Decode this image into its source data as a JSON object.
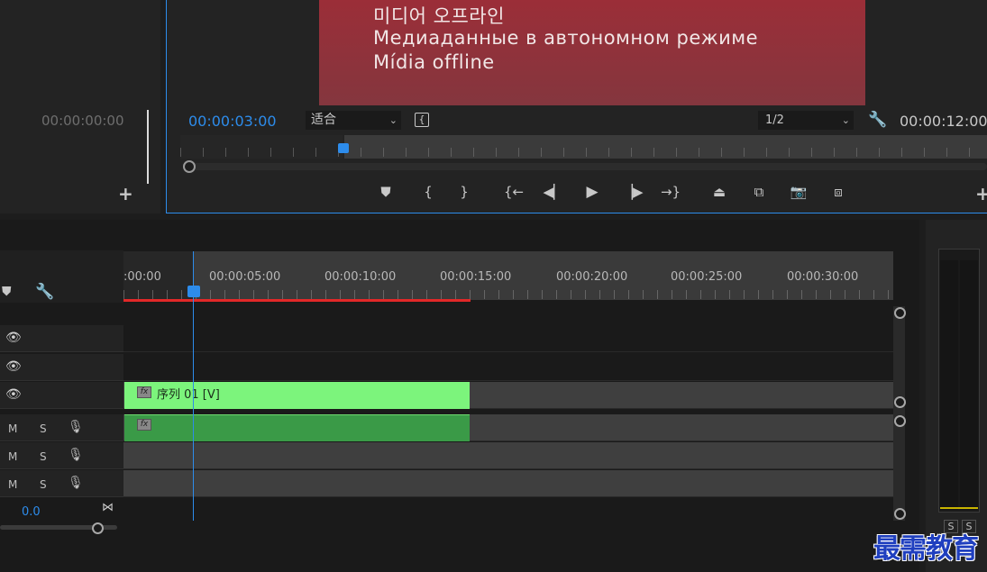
{
  "source_monitor": {
    "timecode": "00:00:00:00",
    "add_label": "+"
  },
  "program_monitor": {
    "offline_lines": [
      "미디어 오프라인",
      "Медиаданные в автономном режиме",
      "Mídia offline"
    ],
    "timecode": "00:00:03:00",
    "fit_value": "适合",
    "resolution_value": "1/2",
    "duration": "00:00:12:00",
    "add_label": "+",
    "transport_icons": [
      "marker-icon",
      "in-point-icon",
      "out-point-icon",
      "go-to-in-icon",
      "step-back-icon",
      "play-icon",
      "step-forward-icon",
      "go-to-out-icon",
      "lift-icon",
      "extract-icon",
      "camera-icon",
      "compare-icon"
    ]
  },
  "timeline": {
    "ruler_labels": [
      ":00:00",
      "00:00:05:00",
      "00:00:10:00",
      "00:00:15:00",
      "00:00:20:00",
      "00:00:25:00",
      "00:00:30:00"
    ],
    "video_clip_label": "序列 01 [V]",
    "fx_label": "fx",
    "track_buttons": {
      "mute": "M",
      "solo": "S"
    },
    "volume_value": "0.0",
    "playhead_color": "#2d8ceb",
    "video_clip_color": "#7cf47c",
    "audio_clip_color": "#3a9a47"
  },
  "meter": {
    "solo_labels": [
      "S",
      "S"
    ]
  },
  "watermark": "最需教育"
}
